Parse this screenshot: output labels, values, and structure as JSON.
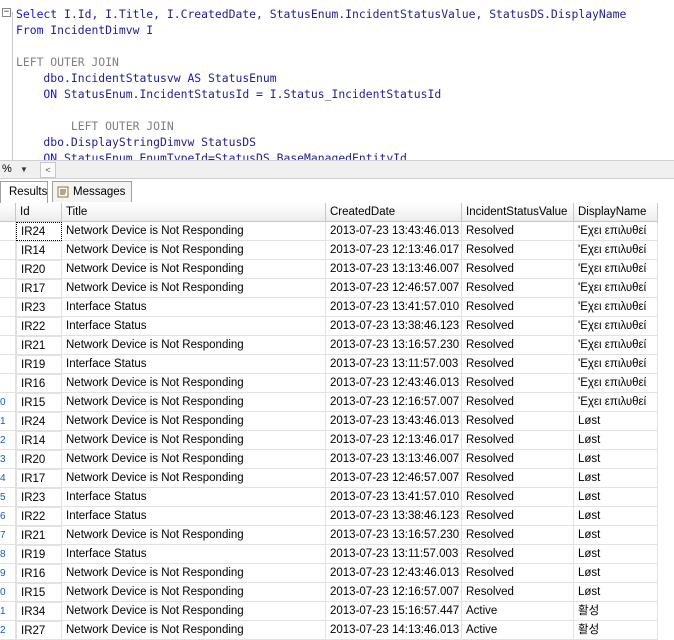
{
  "editor": {
    "collapse_symbol": "−",
    "lines": [
      {
        "parts": [
          [
            "kw",
            "Select"
          ],
          [
            "id",
            " I.Id, I.Title, I.CreatedDate, StatusEnum.IncidentStatusValue, StatusDS.DisplayName"
          ]
        ]
      },
      {
        "parts": [
          [
            "kw",
            "From"
          ],
          [
            "id",
            " IncidentDimvw I"
          ]
        ]
      },
      {
        "parts": []
      },
      {
        "parts": [
          [
            "gr",
            "LEFT OUTER JOIN"
          ]
        ]
      },
      {
        "parts": [
          [
            "id",
            "    dbo.IncidentStatusvw "
          ],
          [
            "kw",
            "AS"
          ],
          [
            "id",
            " StatusEnum"
          ]
        ]
      },
      {
        "parts": [
          [
            "kw",
            "    ON"
          ],
          [
            "id",
            " StatusEnum.IncidentStatusId = I.Status_IncidentStatusId"
          ]
        ]
      },
      {
        "parts": []
      },
      {
        "parts": [
          [
            "gr",
            "        LEFT OUTER JOIN"
          ]
        ]
      },
      {
        "parts": [
          [
            "id",
            "    dbo.DisplayStringDimvw StatusDS"
          ]
        ]
      },
      {
        "parts": [
          [
            "kw",
            "    ON"
          ],
          [
            "id",
            " StatusEnum.EnumTypeId=StatusDS.BaseManagedEntityId"
          ]
        ]
      }
    ]
  },
  "zoom": {
    "label": "%",
    "dropdown_arrow": "▼",
    "scroll_left": "<"
  },
  "tabs": {
    "results": "Results",
    "messages": "Messages"
  },
  "grid": {
    "columns": [
      "Id",
      "Title",
      "CreatedDate",
      "IncidentStatusValue",
      "DisplayName"
    ],
    "rows": [
      {
        "rn": "",
        "id": "IR24",
        "title": "Network Device is Not Responding",
        "created": "2013-07-23 13:43:46.013",
        "status": "Resolved",
        "display": "'Εχει επιλυθεί"
      },
      {
        "rn": "",
        "id": "IR14",
        "title": "Network Device is Not Responding",
        "created": "2013-07-23 12:13:46.017",
        "status": "Resolved",
        "display": "'Εχει επιλυθεί"
      },
      {
        "rn": "",
        "id": "IR20",
        "title": "Network Device is Not Responding",
        "created": "2013-07-23 13:13:46.007",
        "status": "Resolved",
        "display": "'Εχει επιλυθεί"
      },
      {
        "rn": "",
        "id": "IR17",
        "title": "Network Device is Not Responding",
        "created": "2013-07-23 12:46:57.007",
        "status": "Resolved",
        "display": "'Εχει επιλυθεί"
      },
      {
        "rn": "",
        "id": "IR23",
        "title": "Interface Status",
        "created": "2013-07-23 13:41:57.010",
        "status": "Resolved",
        "display": "'Εχει επιλυθεί"
      },
      {
        "rn": "",
        "id": "IR22",
        "title": "Interface Status",
        "created": "2013-07-23 13:38:46.123",
        "status": "Resolved",
        "display": "'Εχει επιλυθεί"
      },
      {
        "rn": "",
        "id": "IR21",
        "title": "Network Device is Not Responding",
        "created": "2013-07-23 13:16:57.230",
        "status": "Resolved",
        "display": "'Εχει επιλυθεί"
      },
      {
        "rn": "",
        "id": "IR19",
        "title": "Interface Status",
        "created": "2013-07-23 13:11:57.003",
        "status": "Resolved",
        "display": "'Εχει επιλυθεί"
      },
      {
        "rn": "",
        "id": "IR16",
        "title": "Network Device is Not Responding",
        "created": "2013-07-23 12:43:46.013",
        "status": "Resolved",
        "display": "'Εχει επιλυθεί"
      },
      {
        "rn": "0",
        "id": "IR15",
        "title": "Network Device is Not Responding",
        "created": "2013-07-23 12:16:57.007",
        "status": "Resolved",
        "display": "'Εχει επιλυθεί"
      },
      {
        "rn": "1",
        "id": "IR24",
        "title": "Network Device is Not Responding",
        "created": "2013-07-23 13:43:46.013",
        "status": "Resolved",
        "display": "Løst"
      },
      {
        "rn": "2",
        "id": "IR14",
        "title": "Network Device is Not Responding",
        "created": "2013-07-23 12:13:46.017",
        "status": "Resolved",
        "display": "Løst"
      },
      {
        "rn": "3",
        "id": "IR20",
        "title": "Network Device is Not Responding",
        "created": "2013-07-23 13:13:46.007",
        "status": "Resolved",
        "display": "Løst"
      },
      {
        "rn": "4",
        "id": "IR17",
        "title": "Network Device is Not Responding",
        "created": "2013-07-23 12:46:57.007",
        "status": "Resolved",
        "display": "Løst"
      },
      {
        "rn": "5",
        "id": "IR23",
        "title": "Interface Status",
        "created": "2013-07-23 13:41:57.010",
        "status": "Resolved",
        "display": "Løst"
      },
      {
        "rn": "6",
        "id": "IR22",
        "title": "Interface Status",
        "created": "2013-07-23 13:38:46.123",
        "status": "Resolved",
        "display": "Løst"
      },
      {
        "rn": "7",
        "id": "IR21",
        "title": "Network Device is Not Responding",
        "created": "2013-07-23 13:16:57.230",
        "status": "Resolved",
        "display": "Løst"
      },
      {
        "rn": "8",
        "id": "IR19",
        "title": "Interface Status",
        "created": "2013-07-23 13:11:57.003",
        "status": "Resolved",
        "display": "Løst"
      },
      {
        "rn": "9",
        "id": "IR16",
        "title": "Network Device is Not Responding",
        "created": "2013-07-23 12:43:46.013",
        "status": "Resolved",
        "display": "Løst"
      },
      {
        "rn": "0",
        "id": "IR15",
        "title": "Network Device is Not Responding",
        "created": "2013-07-23 12:16:57.007",
        "status": "Resolved",
        "display": "Løst"
      },
      {
        "rn": "1",
        "id": "IR34",
        "title": "Network Device is Not Responding",
        "created": "2013-07-23 15:16:57.447",
        "status": "Active",
        "display": "활성"
      },
      {
        "rn": "2",
        "id": "IR27",
        "title": "Network Device is Not Responding",
        "created": "2013-07-23 14:13:46.013",
        "status": "Active",
        "display": "활성"
      }
    ]
  }
}
